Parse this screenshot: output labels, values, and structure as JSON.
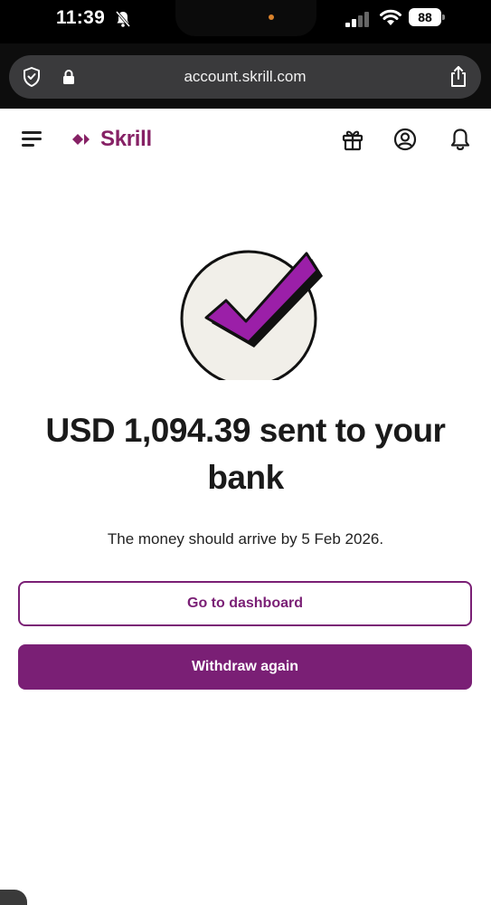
{
  "status_bar": {
    "time": "11:39",
    "battery": "88"
  },
  "browser": {
    "url": "account.skrill.com"
  },
  "header": {
    "brand": "Skrill",
    "icons": [
      "menu-icon",
      "gift-icon",
      "account-icon",
      "bell-icon"
    ]
  },
  "confirmation": {
    "title": "USD 1,094.39 sent to your bank",
    "subtitle": "The money should arrive by 5 Feb 2026."
  },
  "actions": {
    "dashboard_label": "Go to dashboard",
    "withdraw_label": "Withdraw again"
  },
  "colors": {
    "brand": "#862165",
    "button_primary": "#7a1f75",
    "check": "#9b1fa8"
  }
}
